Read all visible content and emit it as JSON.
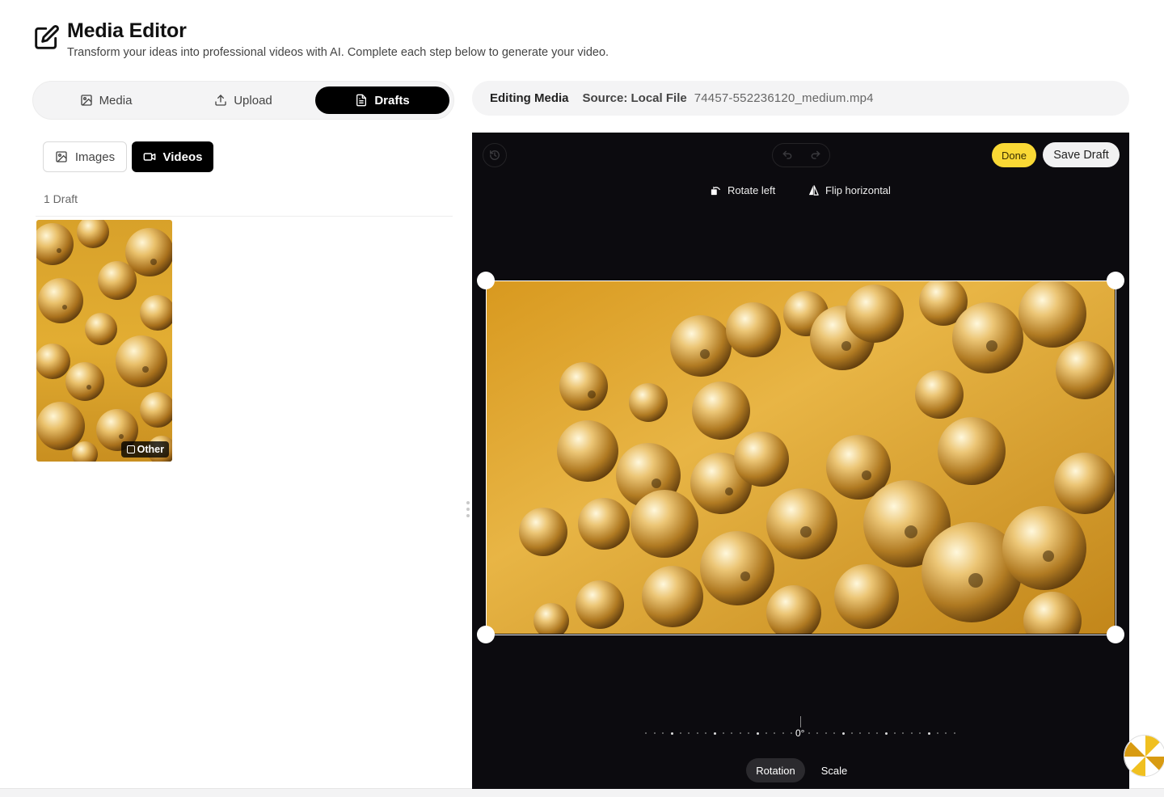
{
  "header": {
    "title": "Media Editor",
    "subtitle": "Transform your ideas into professional videos with AI. Complete each step below to generate your video."
  },
  "tabs": [
    {
      "label": "Media",
      "icon": "image-icon",
      "active": false
    },
    {
      "label": "Upload",
      "icon": "upload-icon",
      "active": false
    },
    {
      "label": "Drafts",
      "icon": "document-icon",
      "active": true
    }
  ],
  "subtabs": [
    {
      "label": "Images",
      "icon": "image-icon",
      "active": false
    },
    {
      "label": "Videos",
      "icon": "video-camera-icon",
      "active": true
    }
  ],
  "drafts": {
    "count_label": "1 Draft",
    "items": [
      {
        "badge": "Other",
        "thumbnail": "golden-bubbles"
      }
    ]
  },
  "infobar": {
    "label": "Editing Media",
    "source": "Source: Local File",
    "filename": "74457-552236120_medium.mp4"
  },
  "editor": {
    "done_label": "Done",
    "save_label": "Save Draft",
    "tools": [
      {
        "label": "Rotate left",
        "icon": "rotate-left-icon"
      },
      {
        "label": "Flip horizontal",
        "icon": "flip-horizontal-icon"
      }
    ],
    "rotation_value": "0°",
    "modes": [
      {
        "label": "Rotation",
        "active": true
      },
      {
        "label": "Scale",
        "active": false
      }
    ]
  },
  "colors": {
    "accent": "#f9d835",
    "editor_bg": "#0c0b0f",
    "active_tab": "#000000"
  }
}
